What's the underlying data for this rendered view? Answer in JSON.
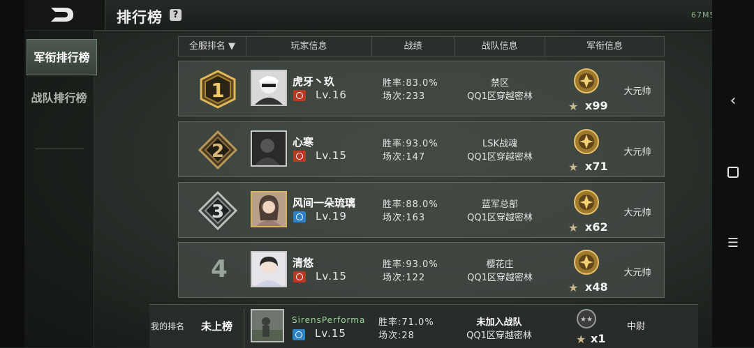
{
  "header": {
    "title": "排行榜",
    "help": "?",
    "status": "67M5"
  },
  "sidebar": {
    "items": [
      {
        "label": "军衔排行榜",
        "active": true
      },
      {
        "label": "战队排行榜",
        "active": false
      }
    ]
  },
  "table": {
    "columns": [
      "全服排名 ▼",
      "玩家信息",
      "战绩",
      "战队信息",
      "军衔信息"
    ],
    "rows": [
      {
        "rank": "1",
        "name": "虎牙丶玖",
        "camp": "red",
        "level": "Lv.16",
        "win_rate": "胜率:83.0%",
        "matches": "场次:233",
        "team": "禁区",
        "region": "QQ1区穿越密林",
        "medal_count": "x99",
        "military_rank": "大元帅"
      },
      {
        "rank": "2",
        "name": "心寒",
        "camp": "red",
        "level": "Lv.15",
        "win_rate": "胜率:93.0%",
        "matches": "场次:147",
        "team": "LSK战魂",
        "region": "QQ1区穿越密林",
        "medal_count": "x71",
        "military_rank": "大元帅"
      },
      {
        "rank": "3",
        "name": "风间一朵琉璃",
        "camp": "blue",
        "level": "Lv.19",
        "win_rate": "胜率:88.0%",
        "matches": "场次:163",
        "team": "蓝军总部",
        "region": "QQ1区穿越密林",
        "medal_count": "x62",
        "military_rank": "大元帅"
      },
      {
        "rank": "4",
        "name": "清悠",
        "camp": "red",
        "level": "Lv.15",
        "win_rate": "胜率:93.0%",
        "matches": "场次:122",
        "team": "樱花庄",
        "region": "QQ1区穿越密林",
        "medal_count": "x48",
        "military_rank": "大元帅"
      }
    ]
  },
  "my_rank": {
    "label": "我的排名",
    "rank": "未上榜",
    "name": "SirensPerforma",
    "camp": "blue",
    "level": "Lv.15",
    "win_rate": "胜率:71.0%",
    "matches": "场次:28",
    "team": "未加入战队",
    "region": "QQ1区穿越密林",
    "medal_count": "x1",
    "military_rank": "中尉"
  },
  "colors": {
    "gold": "#d8b35a",
    "camp_red": "#b83a22",
    "camp_blue": "#2c82c4"
  }
}
